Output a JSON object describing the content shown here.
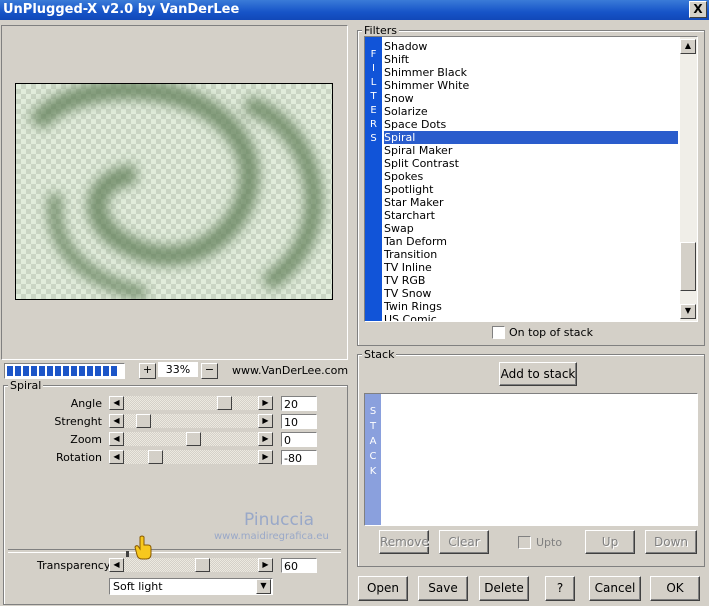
{
  "window": {
    "title": "UnPlugged-X v2.0 by VanDerLee",
    "close_glyph": "X"
  },
  "preview": {
    "zoom_plus": "+",
    "zoom_value": "33%",
    "zoom_minus": "−",
    "website": "www.VanDerLee.com",
    "progress_fraction": 1.0
  },
  "spiral_group": {
    "label": "Spiral",
    "params": [
      {
        "label": "Angle",
        "value": "20",
        "level": 0.78
      },
      {
        "label": "Strenght",
        "value": "10",
        "level": 0.1
      },
      {
        "label": "Zoom",
        "value": "0",
        "level": 0.52
      },
      {
        "label": "Rotation",
        "value": "-80",
        "level": 0.2
      }
    ]
  },
  "watermark": {
    "name": "Pinuccia",
    "url": "www.maidiregrafica.eu"
  },
  "transparency": {
    "label": "Transparency",
    "value": "60",
    "level": 0.6
  },
  "blend_mode": {
    "selected": "Soft light"
  },
  "filters": {
    "label": "Filters",
    "strip_letters": [
      "F",
      "I",
      "L",
      "T",
      "E",
      "R",
      "S"
    ],
    "items": [
      "Shadow",
      "Shift",
      "Shimmer Black",
      "Shimmer White",
      "Snow",
      "Solarize",
      "Space Dots",
      "Spiral",
      "Spiral Maker",
      "Split Contrast",
      "Spokes",
      "Spotlight",
      "Star Maker",
      "Starchart",
      "Swap",
      "Tan Deform",
      "Transition",
      "TV Inline",
      "TV RGB",
      "TV Snow",
      "Twin Rings",
      "US Comic"
    ],
    "selected": "Spiral",
    "on_top_label": "On top of stack"
  },
  "stack": {
    "label": "Stack",
    "add_button": "Add to stack",
    "strip_letters": [
      "S",
      "T",
      "A",
      "C",
      "K"
    ],
    "remove": "Remove",
    "clear": "Clear",
    "upto": "Upto",
    "up": "Up",
    "down": "Down"
  },
  "buttons": {
    "open": "Open",
    "save": "Save",
    "delete": "Delete",
    "help": "?",
    "cancel": "Cancel",
    "ok": "OK"
  },
  "colors": {
    "titlebar": "#1654c8",
    "selection": "#2a5ccc",
    "filter_strip": "#1154d8",
    "stack_strip": "#8aa0dd"
  }
}
